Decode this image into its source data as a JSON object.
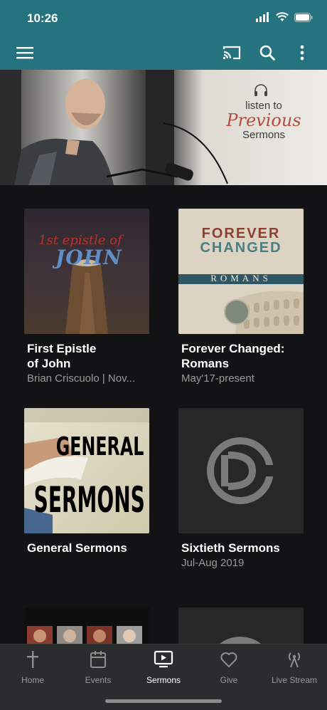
{
  "status": {
    "time": "10:26"
  },
  "hero": {
    "line1": "listen to",
    "line2": "Previous",
    "line3": "Sermons"
  },
  "series": [
    {
      "title": "First Epistle of John",
      "title_l1": "First Epistle",
      "title_l2": "of John",
      "subtitle": "Brian Criscuolo | Nov...",
      "art_text": [
        "1st epistle of",
        "JOHN"
      ]
    },
    {
      "title": "Forever Changed: Romans",
      "title_l1": "Forever Changed:",
      "title_l2": "Romans",
      "subtitle": "May'17-present",
      "art_text": [
        "FOREVER",
        "CHANGED",
        "ROMANS"
      ]
    },
    {
      "title": "General Sermons",
      "title_l1": "General Sermons",
      "title_l2": "",
      "subtitle": "",
      "art_text": [
        "GENERAL",
        "SERMONS"
      ]
    },
    {
      "title": "Sixtieth Sermons",
      "title_l1": "Sixtieth Sermons",
      "title_l2": "",
      "subtitle": "Jul-Aug 2019",
      "art_text": []
    }
  ],
  "nav": [
    {
      "label": "Home",
      "icon": "cross-icon"
    },
    {
      "label": "Events",
      "icon": "calendar-icon"
    },
    {
      "label": "Sermons",
      "icon": "play-screen-icon",
      "active": true
    },
    {
      "label": "Give",
      "icon": "heart-icon"
    },
    {
      "label": "Live Stream",
      "icon": "broadcast-icon"
    }
  ],
  "colors": {
    "header": "#24737f",
    "background": "#121314",
    "nav": "#2a2c2d",
    "accent_red": "#b34e3d"
  }
}
